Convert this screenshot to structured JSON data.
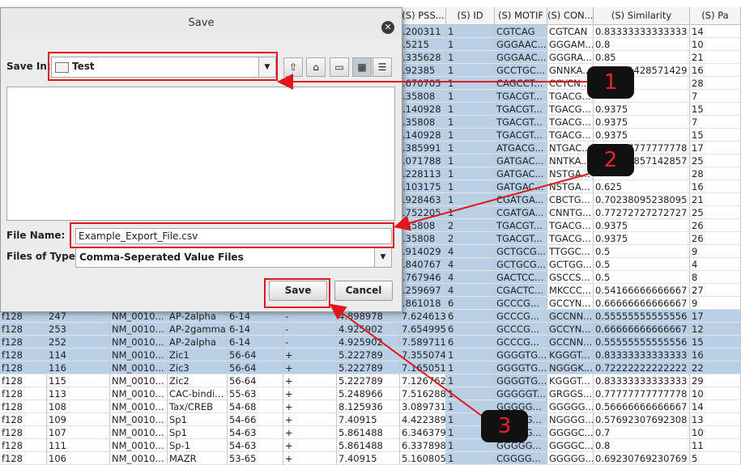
{
  "table": {
    "headers": [
      "(S) PSS...",
      "(S) ID",
      "(S) MOTIF",
      "(S) CON...",
      "(S) Similarity",
      "(S) Pa"
    ],
    "top_rows": [
      {
        "pss": ".200311",
        "id": "1",
        "motif": "CGTCAG",
        "con": "CGTCAN",
        "sim": "0.83333333333333",
        "pa": "14"
      },
      {
        "pss": ".5215",
        "id": "1",
        "motif": "GGGAAC...",
        "con": "GGGAM...",
        "sim": "0.8",
        "pa": "10"
      },
      {
        "pss": ".335628",
        "id": "1",
        "motif": "GGGAAC...",
        "con": "GGGRA...",
        "sim": "0.85",
        "pa": "21"
      },
      {
        "pss": ".92385",
        "id": "1",
        "motif": "GCCTGC...",
        "con": "GNNKA...",
        "sim": "0.52571428571429",
        "pa": "16"
      },
      {
        "pss": ".670705",
        "id": "1",
        "motif": "CAGCCT...",
        "con": "CCYCN...",
        "sim": "",
        "pa": "28"
      },
      {
        "pss": ".35808",
        "id": "1",
        "motif": "TGACGT...",
        "con": "TGACG...",
        "sim": "",
        "pa": "7"
      },
      {
        "pss": ".140928",
        "id": "1",
        "motif": "TGACGT...",
        "con": "TGACG...",
        "sim": "0.9375",
        "pa": "15"
      },
      {
        "pss": ".35808",
        "id": "1",
        "motif": "TGACGT...",
        "con": "TGACG...",
        "sim": "0.9375",
        "pa": "7"
      },
      {
        "pss": ".140928",
        "id": "1",
        "motif": "TGACGT...",
        "con": "TGACG...",
        "sim": "0.9375",
        "pa": "15"
      },
      {
        "pss": ".385991",
        "id": "1",
        "motif": "ATGACG...",
        "con": "NTGAC...",
        "sim": "0.77777777777778",
        "pa": "17"
      },
      {
        "pss": ".071788",
        "id": "1",
        "motif": "GATGAC...",
        "con": "NNTKA...",
        "sim": "0.57142857142857",
        "pa": "25"
      },
      {
        "pss": ".228113",
        "id": "1",
        "motif": "GATGAC...",
        "con": "NSTGA...",
        "sim": "",
        "pa": "28"
      },
      {
        "pss": ".103175",
        "id": "1",
        "motif": "GATGAC...",
        "con": "NSTGA...",
        "sim": "0.625",
        "pa": "16"
      },
      {
        "pss": ".928463",
        "id": "1",
        "motif": "CGATGA...",
        "con": "CBCTG...",
        "sim": "0.70238095238095",
        "pa": "21"
      },
      {
        "pss": ".752205",
        "id": "1",
        "motif": "CGATGA...",
        "con": "CNNTG...",
        "sim": "0.77272727272727",
        "pa": "25"
      },
      {
        "pss": ".35808",
        "id": "2",
        "motif": "TGACGT...",
        "con": "TGACG...",
        "sim": "0.9375",
        "pa": "26"
      },
      {
        "pss": ".35808",
        "id": "2",
        "motif": "TGACGT...",
        "con": "TGACG...",
        "sim": "0.9375",
        "pa": "26"
      },
      {
        "pss": ".914029",
        "id": "4",
        "motif": "GCTGCG...",
        "con": "TTGGC...",
        "sim": "0.5",
        "pa": "9"
      },
      {
        "pss": ".840767",
        "id": "4",
        "motif": "GCTGCG...",
        "con": "GCTGG...",
        "sim": "0.5",
        "pa": "4"
      },
      {
        "pss": ".767946",
        "id": "4",
        "motif": "GACTCC...",
        "con": "GSCCS...",
        "sim": "0.5",
        "pa": "8"
      },
      {
        "pss": ".259697",
        "id": "4",
        "motif": "CGACTC...",
        "con": "MKCCC...",
        "sim": "0.54166666666667",
        "pa": "27"
      },
      {
        "pss": ".861018",
        "id": "6",
        "motif": "GCCCG...",
        "con": "GCCYN...",
        "sim": "0.66666666666667",
        "pa": "9"
      }
    ],
    "full_rows": [
      {
        "a": "f128",
        "b": "247",
        "c": "NM_0010...",
        "d": "AP-2alpha",
        "e": "6-14",
        "f": "-",
        "g": "+",
        "h": "4.898978",
        "i": "7.624613",
        "id": "6",
        "motif": "GCCCG...",
        "con": "GCCNN...",
        "sim": "0.55555555555556",
        "pa": "17",
        "sel": true
      },
      {
        "a": "f128",
        "b": "253",
        "c": "NM_0010...",
        "d": "AP-2gamma",
        "e": "6-14",
        "f": "-",
        "g": "+",
        "h": "4.925902",
        "i": "7.654995",
        "id": "6",
        "motif": "GCCCG...",
        "con": "GCCYN...",
        "sim": "0.66666666666667",
        "pa": "12",
        "sel": true
      },
      {
        "a": "f128",
        "b": "252",
        "c": "NM_0010...",
        "d": "AP-2alpha",
        "e": "6-14",
        "f": "-",
        "g": "+",
        "h": "4.925902",
        "i": "7.589711",
        "id": "6",
        "motif": "GCCCG...",
        "con": "GCCNN...",
        "sim": "0.55555555555556",
        "pa": "15",
        "sel": true
      },
      {
        "a": "f128",
        "b": "114",
        "c": "NM_0010...",
        "d": "Zic1",
        "e": "56-64",
        "f": "+",
        "g": "",
        "h": "5.222789",
        "i": "7.355074",
        "id": "1",
        "motif": "GGGGTG...",
        "con": "KGGGT...",
        "sim": "0.83333333333333",
        "pa": "16",
        "sel": true
      },
      {
        "a": "f128",
        "b": "116",
        "c": "NM_0010...",
        "d": "Zic3",
        "e": "56-64",
        "f": "+",
        "g": "",
        "h": "5.222789",
        "i": "7.165051",
        "id": "1",
        "motif": "GGGGTG...",
        "con": "NGGGK...",
        "sim": "0.72222222222222",
        "pa": "22",
        "sel": true
      },
      {
        "a": "f128",
        "b": "115",
        "c": "NM_0010...",
        "d": "Zic2",
        "e": "56-64",
        "f": "+",
        "g": "",
        "h": "5.222789",
        "i": "7.126762",
        "id": "1",
        "motif": "GGGGTG...",
        "con": "KGGGT...",
        "sim": "0.83333333333333",
        "pa": "29",
        "sel": false
      },
      {
        "a": "f128",
        "b": "113",
        "c": "NM_0010...",
        "d": "CAC-bindi...",
        "e": "55-63",
        "f": "+",
        "g": "",
        "h": "5.248966",
        "i": "7.516288",
        "id": "1",
        "motif": "GGGGGT...",
        "con": "GRGGS...",
        "sim": "0.77777777777778",
        "pa": "10",
        "sel": false
      },
      {
        "a": "f128",
        "b": "108",
        "c": "NM_0010...",
        "d": "Tax/CREB",
        "e": "54-68",
        "f": "+",
        "g": "",
        "h": "8.125936",
        "i": "3.089731",
        "id": "1",
        "motif": "GGGGG...",
        "con": "GGGGG...",
        "sim": "0.56666666666667",
        "pa": "14",
        "sel": false
      },
      {
        "a": "f128",
        "b": "109",
        "c": "NM_0010...",
        "d": "Sp1",
        "e": "54-66",
        "f": "+",
        "g": "",
        "h": "7.40915",
        "i": "4.422389",
        "id": "1",
        "motif": "GGGGG...",
        "con": "NGGGG...",
        "sim": "0.57692307692308",
        "pa": "13",
        "sel": false
      },
      {
        "a": "f128",
        "b": "107",
        "c": "NM_0010...",
        "d": "Sp1",
        "e": "54-63",
        "f": "+",
        "g": "",
        "h": "5.861488",
        "i": "6.346379",
        "id": "1",
        "motif": "GGGGG...",
        "con": "GGGGC...",
        "sim": "0.7",
        "pa": "10",
        "sel": false
      },
      {
        "a": "f128",
        "b": "111",
        "c": "NM_0010...",
        "d": "Sp-1",
        "e": "54-63",
        "f": "+",
        "g": "",
        "h": "5.861488",
        "i": "6.337898",
        "id": "1",
        "motif": "GGGGG...",
        "con": "GGGGC...",
        "sim": "0.8",
        "pa": "11",
        "sel": false
      },
      {
        "a": "f128",
        "b": "106",
        "c": "NM_0010...",
        "d": "MAZR",
        "e": "53-65",
        "f": "+",
        "g": "",
        "h": "7.40915",
        "i": "5.160805",
        "id": "1",
        "motif": "CGGGG...",
        "con": "GGGGG...",
        "sim": "0.69230769230769",
        "pa": "5",
        "sel": false
      }
    ]
  },
  "dialog": {
    "title": "Save",
    "save_in_label": "Save In:",
    "save_in_value": "Test",
    "file_name_label": "File Name:",
    "file_name_value": "Example_Export_File.csv",
    "file_type_label": "Files of Type:",
    "file_type_value": "Comma-Seperated Value Files",
    "save_label": "Save",
    "cancel_label": "Cancel"
  },
  "annotations": {
    "badge1": "1",
    "badge2": "2",
    "badge3": "3",
    "color": "#e0161c"
  }
}
